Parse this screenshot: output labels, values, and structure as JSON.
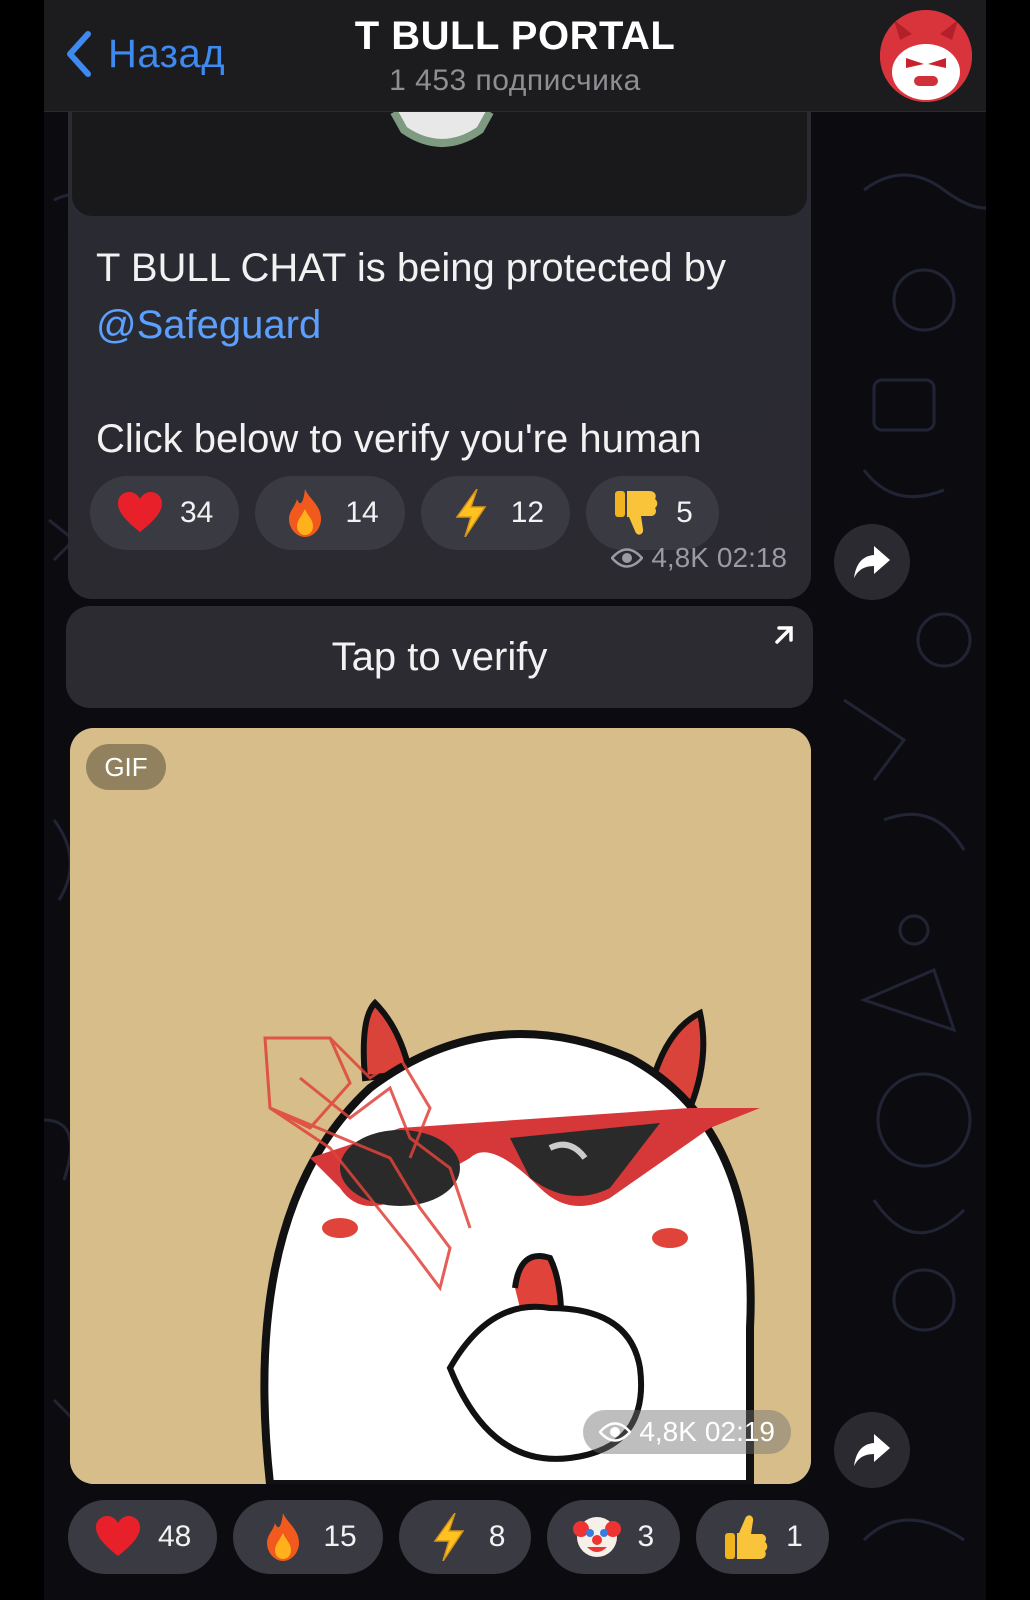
{
  "header": {
    "back_label": "Назад",
    "title": "T BULL PORTAL",
    "subtitle": "1 453 подписчика"
  },
  "message1": {
    "text_line1": "T BULL CHAT is being protected by",
    "mention": "@Safeguard",
    "text_line2": "Click below to verify you're human",
    "reactions": [
      {
        "emoji": "heart",
        "count": "34"
      },
      {
        "emoji": "fire",
        "count": "14"
      },
      {
        "emoji": "lightning",
        "count": "12"
      },
      {
        "emoji": "thumbs-down",
        "count": "5"
      }
    ],
    "views": "4,8K",
    "time": "02:18"
  },
  "verify_button": {
    "label": "Tap to verify"
  },
  "gif_message": {
    "badge": "GIF",
    "views": "4,8K",
    "time": "02:19",
    "background_color": "#d6bd8a",
    "reactions": [
      {
        "emoji": "heart",
        "count": "48"
      },
      {
        "emoji": "fire",
        "count": "15"
      },
      {
        "emoji": "lightning",
        "count": "8"
      },
      {
        "emoji": "clown",
        "count": "3"
      },
      {
        "emoji": "thumbs-up",
        "count": "1"
      }
    ]
  },
  "colors": {
    "accent": "#3e8af0",
    "link": "#5ba0ff",
    "bubble": "#2a2b33"
  }
}
